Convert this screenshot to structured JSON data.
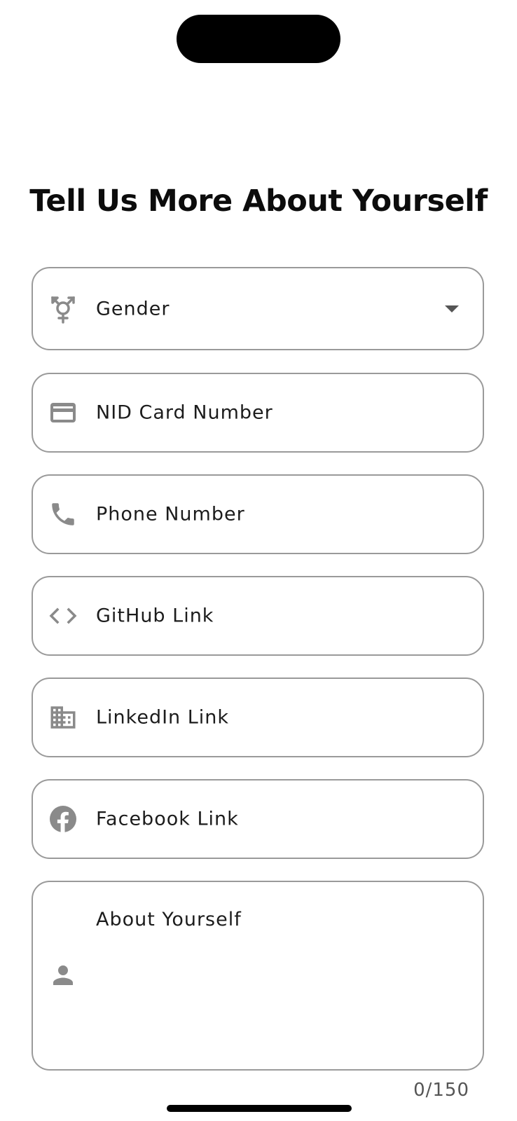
{
  "page": {
    "title": "Tell Us More About Yourself"
  },
  "fields": {
    "gender": {
      "placeholder": "Gender",
      "icon": "gender-icon",
      "type": "dropdown"
    },
    "nid": {
      "placeholder": "NID Card Number",
      "icon": "credit-card-icon"
    },
    "phone": {
      "placeholder": "Phone Number",
      "icon": "phone-icon"
    },
    "github": {
      "placeholder": "GitHub Link",
      "icon": "code-icon"
    },
    "linkedin": {
      "placeholder": "LinkedIn Link",
      "icon": "building-icon"
    },
    "facebook": {
      "placeholder": "Facebook Link",
      "icon": "facebook-icon"
    },
    "about": {
      "placeholder": "About Yourself",
      "icon": "person-icon",
      "counter": "0/150"
    }
  },
  "colors": {
    "border": "#9a9a9a",
    "icon": "#8a8a8a",
    "text": "#1c1c1c",
    "title": "#0c0c0c"
  }
}
